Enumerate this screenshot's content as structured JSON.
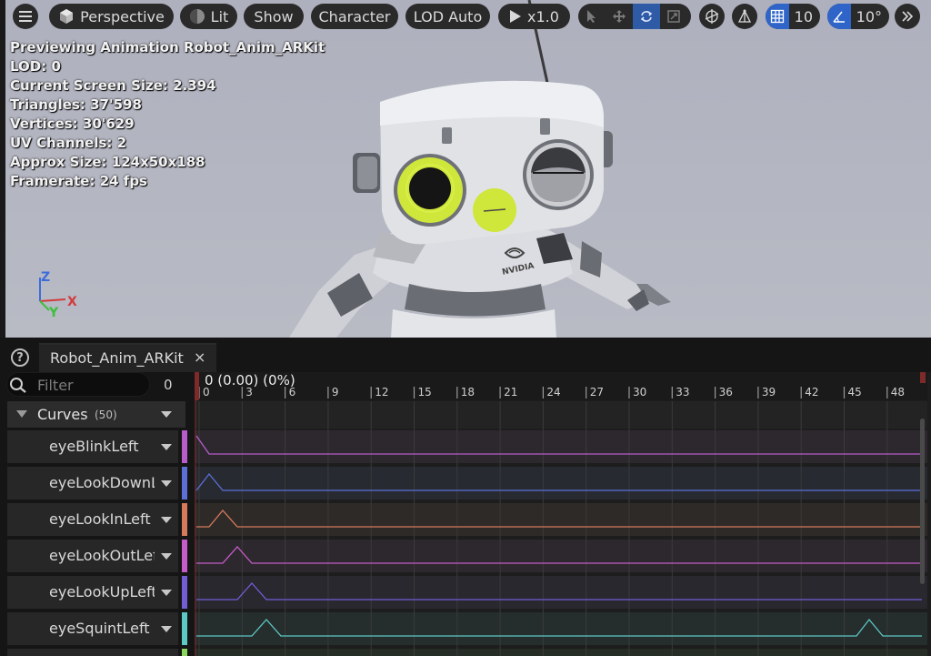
{
  "toolbar": {
    "menu_icon": "hamburger-icon",
    "perspective_label": "Perspective",
    "lit_label": "Lit",
    "show_label": "Show",
    "character_label": "Character",
    "lod_label": "LOD Auto",
    "play_speed_label": "x1.0",
    "grid_snap_value": "10",
    "rotation_snap_value": "10°",
    "transform_tools": [
      "select-icon",
      "translate-icon",
      "rotate-icon",
      "scale-icon"
    ],
    "active_tool": "rotate-icon",
    "accent_color": "#2f65c8"
  },
  "stats": {
    "previewing": "Previewing Animation Robot_Anim_ARKit",
    "lod": "LOD: 0",
    "screen_size": "Current Screen Size: 2.394",
    "triangles": "Triangles: 37'598",
    "vertices": "Vertices: 30'629",
    "uv_channels": "UV Channels: 2",
    "approx_size": "Approx Size: 124x50x188",
    "framerate": "Framerate: 24 fps"
  },
  "gizmo": {
    "z": "Z",
    "x": "X",
    "y": "Y"
  },
  "scene": {
    "chest_logo": "NVIDIA"
  },
  "tab": {
    "title": "Robot_Anim_ARKit",
    "close": "×",
    "help": "?"
  },
  "curves_panel": {
    "filter_placeholder": "Filter",
    "filter_count": "0",
    "header_label": "Curves",
    "header_count": "(50)",
    "rows": [
      {
        "name": "eyeBlinkLeft",
        "color": "#b85ccb"
      },
      {
        "name": "eyeLookDownLeft",
        "color": "#5c6fd6"
      },
      {
        "name": "eyeLookInLeft",
        "color": "#d67a5c"
      },
      {
        "name": "eyeLookOutLeft",
        "color": "#c65cc9"
      },
      {
        "name": "eyeLookUpLeft",
        "color": "#735cd6"
      },
      {
        "name": "eyeSquintLeft",
        "color": "#5cc9c4"
      }
    ]
  },
  "timeline": {
    "current_time": "0 (0.00) (0%)",
    "ticks": [
      "0",
      "3",
      "6",
      "9",
      "12",
      "15",
      "18",
      "21",
      "24",
      "27",
      "30",
      "33",
      "36",
      "39",
      "42",
      "45",
      "48"
    ]
  }
}
